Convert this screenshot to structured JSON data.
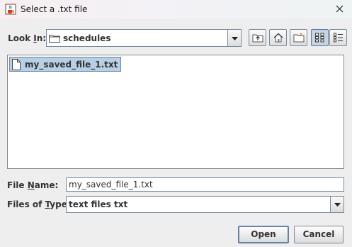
{
  "window": {
    "title": "Select a .txt file",
    "app_icon": "java-cup-icon",
    "close_icon": "close-icon"
  },
  "look_in": {
    "label": "Look In:",
    "mnemonic_char": "I",
    "value": "schedules",
    "icon": "folder-icon"
  },
  "toolbar": {
    "buttons": [
      {
        "name": "up-one-level",
        "icon": "folder-up-icon"
      },
      {
        "name": "home",
        "icon": "home-icon"
      },
      {
        "name": "create-new-folder",
        "icon": "new-folder-icon"
      },
      {
        "name": "list-view",
        "icon": "list-view-icon",
        "active": true
      },
      {
        "name": "details-view",
        "icon": "details-view-icon",
        "active": false
      }
    ]
  },
  "file_list": {
    "items": [
      {
        "name": "my_saved_file_1.txt",
        "icon": "file-icon",
        "selected": true
      }
    ]
  },
  "file_name": {
    "label": "File Name:",
    "mnemonic_char": "N",
    "value": "my_saved_file_1.txt"
  },
  "files_of_type": {
    "label": "Files of Type:",
    "mnemonic_char": "T",
    "value": "text files txt"
  },
  "actions": {
    "open_label": "Open",
    "cancel_label": "Cancel"
  },
  "colors": {
    "selection": "#b8cfe5",
    "default_button_border": "#6382a6",
    "window_bg": "#eeeeee"
  }
}
